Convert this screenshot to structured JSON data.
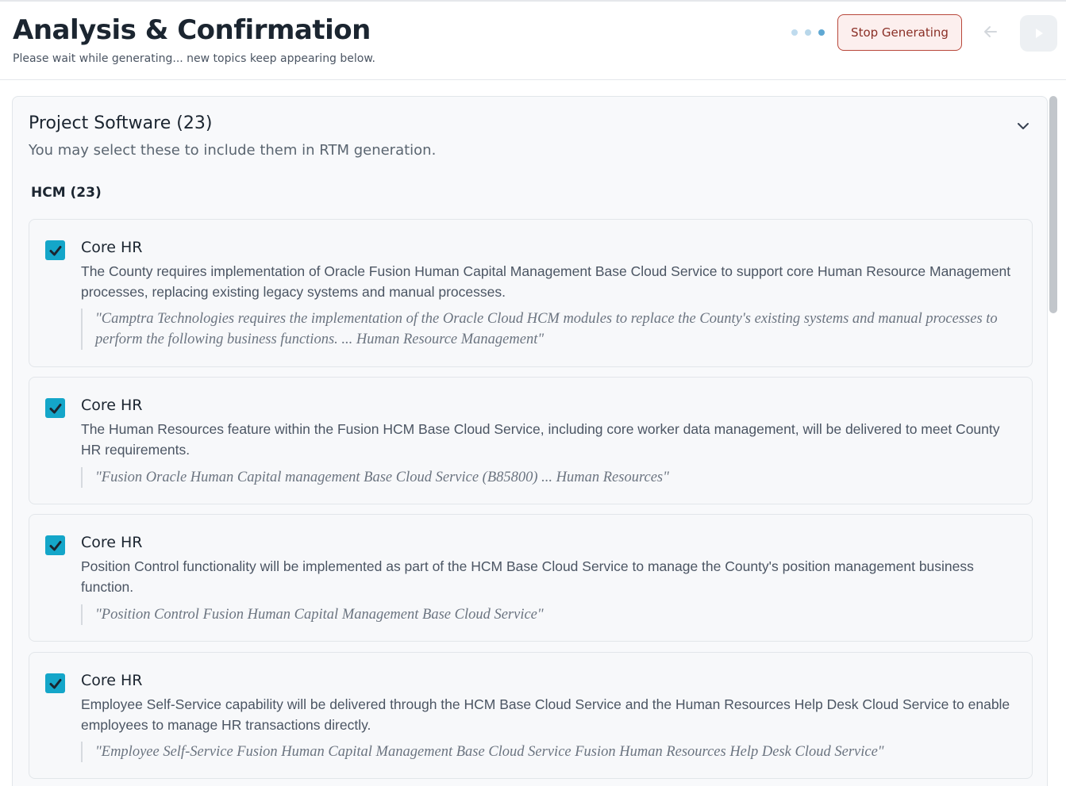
{
  "header": {
    "title": "Analysis & Confirmation",
    "subtitle": "Please wait while generating... new topics keep appearing below.",
    "stop_label": "Stop Generating",
    "back_icon": "arrow-left-icon",
    "play_icon": "play-icon"
  },
  "section": {
    "title": "Project Software (23)",
    "description": "You may select these to include them in RTM generation.",
    "collapse_icon": "chevron-down-icon",
    "group": {
      "title": "HCM (23)",
      "items": [
        {
          "checked": true,
          "title": "Core HR",
          "description": "The County requires implementation of Oracle Fusion Human Capital Management Base Cloud Service to support core Human Resource Management processes, replacing existing legacy systems and manual processes.",
          "quote": "\"Camptra Technologies requires the implementation of the Oracle Cloud HCM modules to replace the County's existing systems and manual processes to perform the following business functions. ... Human Resource Management\""
        },
        {
          "checked": true,
          "title": "Core HR",
          "description": "The Human Resources feature within the Fusion HCM Base Cloud Service, including core worker data management, will be delivered to meet County HR requirements.",
          "quote": "\"Fusion Oracle Human Capital management Base Cloud Service (B85800) ... Human Resources\""
        },
        {
          "checked": true,
          "title": "Core HR",
          "description": "Position Control functionality will be implemented as part of the HCM Base Cloud Service to manage the County's position management business function.",
          "quote": "\"Position Control Fusion Human Capital Management Base Cloud Service\""
        },
        {
          "checked": true,
          "title": "Core HR",
          "description": "Employee Self-Service capability will be delivered through the HCM Base Cloud Service and the Human Resources Help Desk Cloud Service to enable employees to manage HR transactions directly.",
          "quote": "\"Employee Self-Service Fusion Human Capital Management Base Cloud Service Fusion Human Resources Help Desk Cloud Service\""
        }
      ]
    }
  },
  "colors": {
    "accent": "#14a6c9",
    "stop_border": "#b8473a",
    "stop_background": "#fcefee"
  }
}
